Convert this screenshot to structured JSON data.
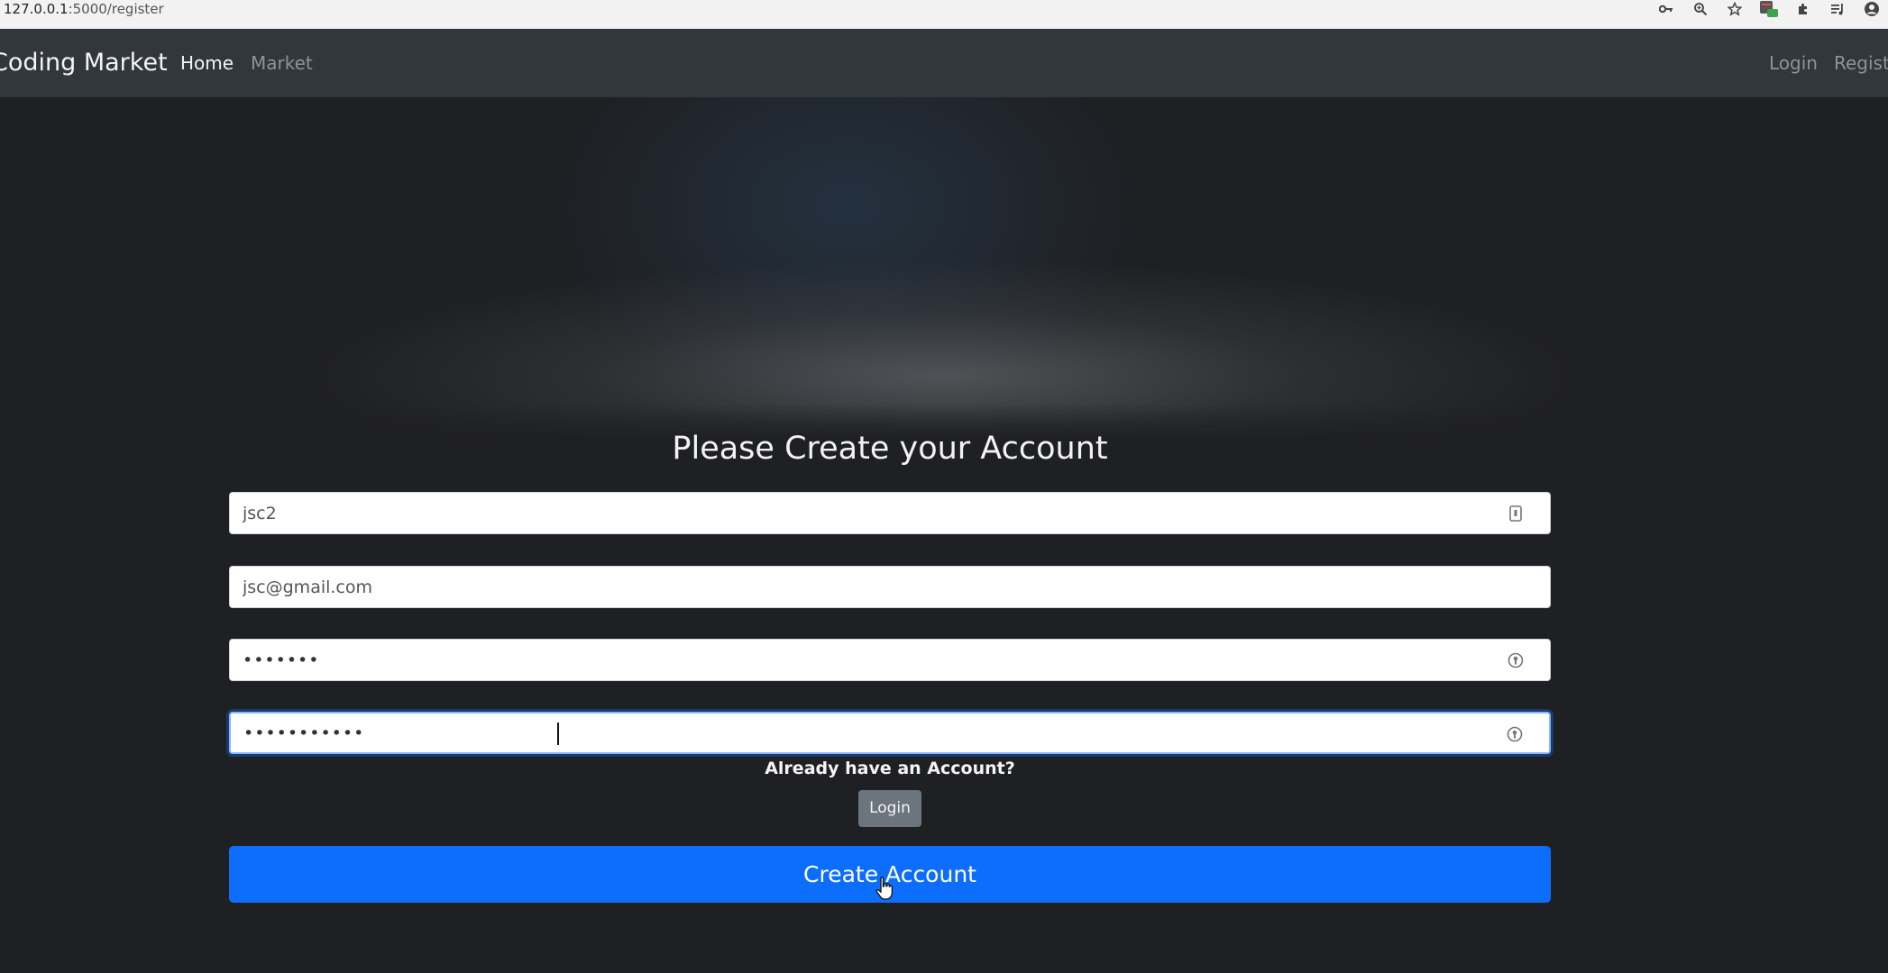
{
  "browser": {
    "url_host": "127.0.0.1",
    "url_rest": ":5000/register",
    "toolbar_icons": [
      "key-icon",
      "zoom-icon",
      "star-icon",
      "extension-badge-icon",
      "puzzle-icon",
      "reading-list-icon",
      "profile-icon"
    ]
  },
  "navbar": {
    "brand": "Coding Market",
    "links": {
      "home": "Home",
      "market": "Market",
      "login": "Login",
      "register": "Register"
    }
  },
  "form": {
    "title": "Please Create your Account",
    "username_value": "jsc2",
    "email_value": "jsc@gmail.com",
    "password_value": "•••••••",
    "confirm_password_value": "•••••••••••",
    "already_text": "Already have an Account?",
    "login_button": "Login",
    "submit_button": "Create Account"
  },
  "colors": {
    "navbar_bg": "#32363d",
    "page_bg": "#1f2024",
    "primary": "#0d6efd",
    "secondary": "#6c757d"
  }
}
